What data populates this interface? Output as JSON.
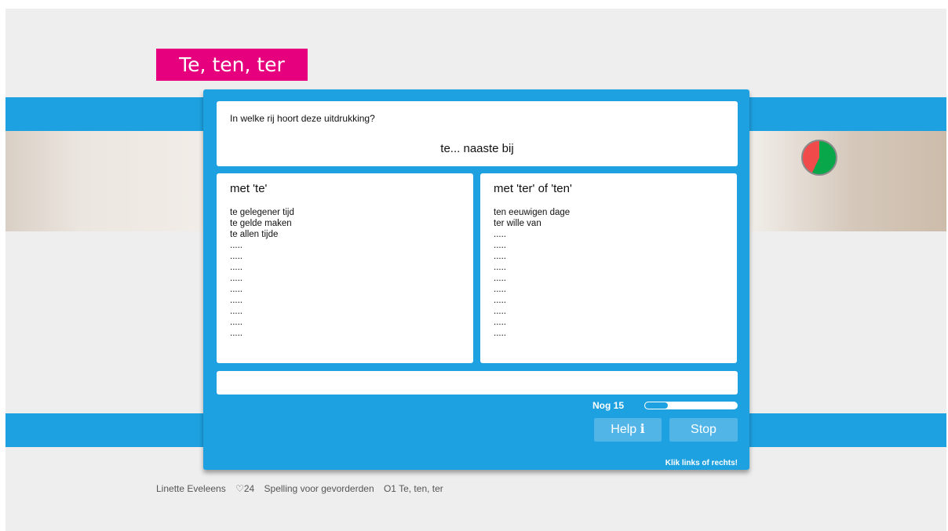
{
  "app": {
    "title": "Te, ten, ter"
  },
  "question": {
    "prompt": "In welke rij hoort deze uitdrukking?",
    "expression": "te... naaste bij"
  },
  "columns": {
    "left": {
      "heading": "met 'te'",
      "items": [
        "te gelegener tijd",
        "te gelde maken",
        "te allen tijde",
        ".....",
        ".....",
        ".....",
        ".....",
        ".....",
        ".....",
        ".....",
        ".....",
        "....."
      ]
    },
    "right": {
      "heading": "met 'ter' of 'ten'",
      "items": [
        "ten eeuwigen dage",
        "ter wille van",
        ".....",
        ".....",
        ".....",
        ".....",
        ".....",
        ".....",
        ".....",
        ".....",
        ".....",
        "....."
      ]
    }
  },
  "answer": {
    "value": ""
  },
  "progress": {
    "label": "Nog 15",
    "fraction": 0.25
  },
  "buttons": {
    "help": "Help ℹ",
    "stop": "Stop"
  },
  "hint": "Klik links of rechts!",
  "footer": {
    "author": "Linette Eveleens",
    "likes": "♡24",
    "course": "Spelling voor gevorderden",
    "lesson": "O1 Te, ten, ter"
  },
  "colors": {
    "accent": "#1ea1e0",
    "brand": "#e6007e",
    "correct": "#08a84a",
    "wrong": "#f04a4a"
  },
  "score": {
    "correct_fraction": 0.57
  }
}
